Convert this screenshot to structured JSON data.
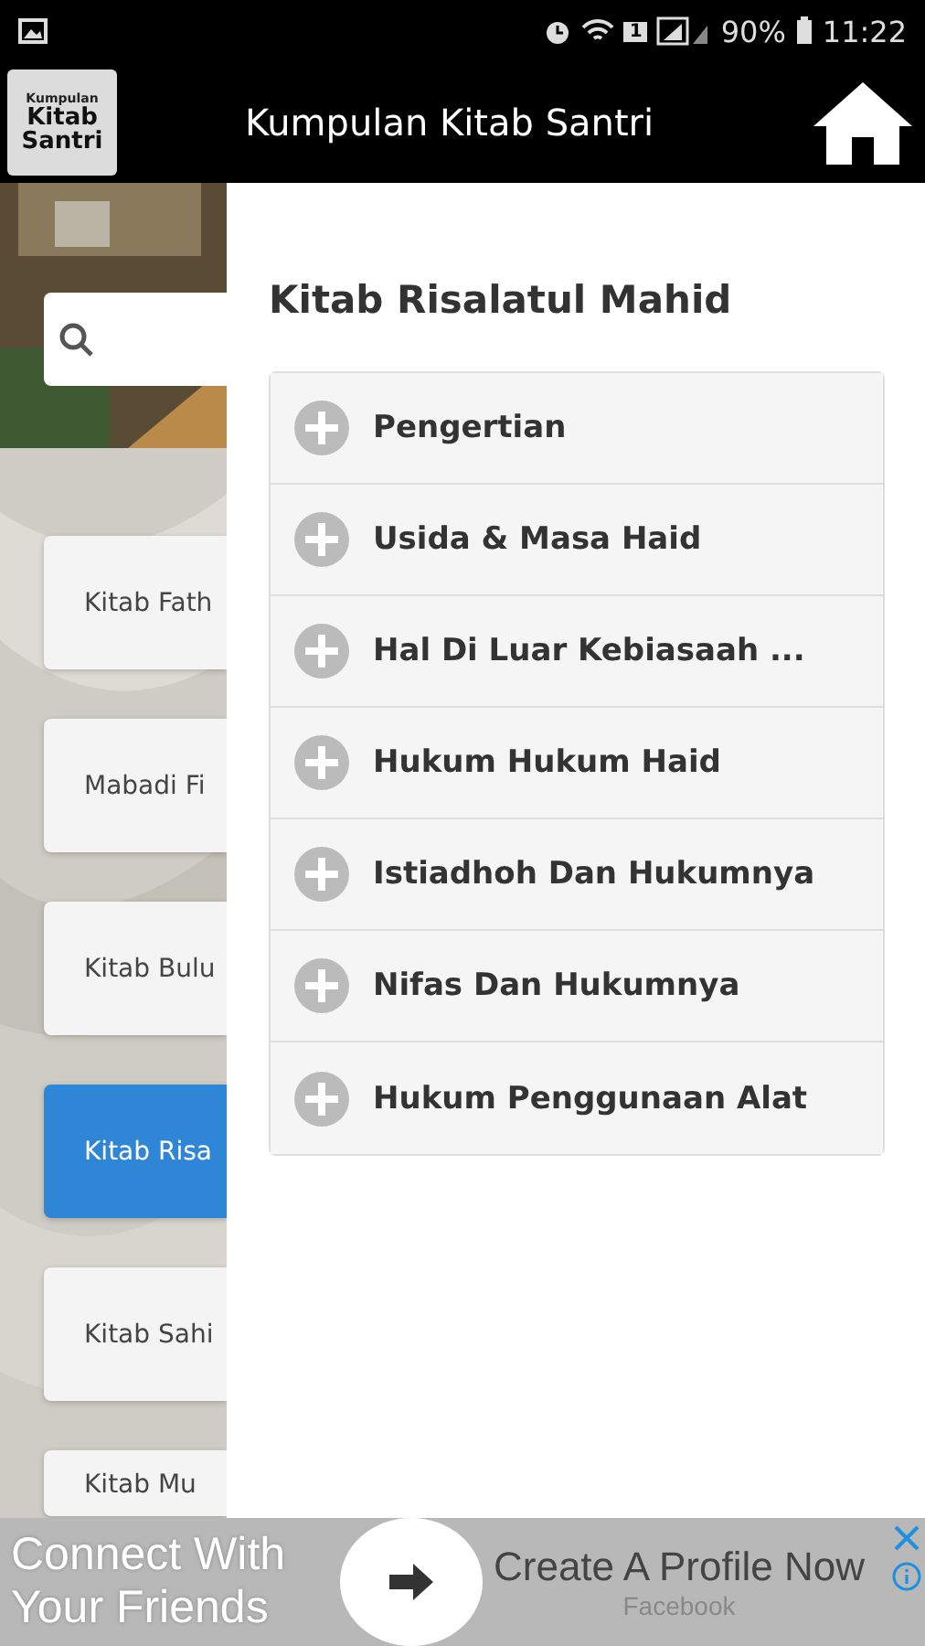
{
  "status_bar": {
    "battery": "90%",
    "time": "11:22",
    "sim": "1"
  },
  "app_bar": {
    "logo_lines": [
      "Kumpulan",
      "Kitab",
      "Santri"
    ],
    "title": "Kumpulan Kitab Santri"
  },
  "books": [
    {
      "title": "Kitab Fath",
      "selected": false
    },
    {
      "title": "Mabadi Fi",
      "selected": false
    },
    {
      "title": "Kitab Bulu",
      "selected": false
    },
    {
      "title": "Kitab Risa",
      "selected": true
    },
    {
      "title": "Kitab Sahi",
      "selected": false
    },
    {
      "title": "Kitab Mu",
      "selected": false
    }
  ],
  "panel": {
    "title": "Kitab Risalatul Mahid",
    "sections": [
      {
        "label": "Pengertian",
        "expanded": false
      },
      {
        "label": "Usida & Masa Haid",
        "expanded": false
      },
      {
        "label": "Hal Di Luar Kebiasaah ...",
        "expanded": false
      },
      {
        "label": "Hukum Hukum Haid",
        "expanded": false
      },
      {
        "label": "Istiadhoh Dan Hukumnya",
        "expanded": false
      },
      {
        "label": "Nifas Dan Hukumnya",
        "expanded": false
      },
      {
        "label": "Hukum Penggunaan Alat",
        "expanded": false
      }
    ]
  },
  "ad": {
    "tagline": "Connect With Your Friends",
    "headline": "Create A Profile Now",
    "advertiser": "Facebook"
  }
}
